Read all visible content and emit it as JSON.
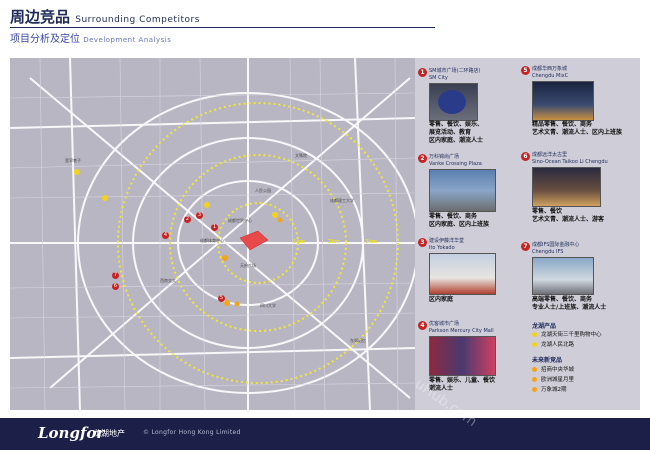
{
  "header": {
    "title_cn": "周边竞品",
    "title_en": "Surrounding Competitors",
    "subtitle_cn": "项目分析及定位",
    "subtitle_en": "Development Analysis"
  },
  "map": {
    "ring_labels": [
      "1km",
      "2km",
      "3km"
    ],
    "site_labels": [
      "成都世贸中心",
      "天府广场",
      "成都体育中心",
      "四川大学",
      "西南交大",
      "人民公园",
      "文殊院",
      "宽窄巷子",
      "成都理工大学",
      "东郊记忆"
    ]
  },
  "competitors": [
    {
      "num": "1",
      "name": "SM城市广场(二环路店)",
      "name_en": "SM City",
      "desc": "零售、餐饮、娱乐、\n展览活动、教育\n区内家庭、潮流人士"
    },
    {
      "num": "2",
      "name": "万科锦尚广场",
      "name_en": "Vanke Crossing Plaza",
      "desc": "零售、餐饮、商务\n区内家庭、区内上班族"
    },
    {
      "num": "3",
      "name": "建设伊藤洋华堂",
      "name_en": "Ito Yokado",
      "desc": "区内家庭"
    },
    {
      "num": "4",
      "name": "优客城市广场",
      "name_en": "Parkson Mercury City Mall",
      "desc": "零售、娱乐、儿童、餐饮\n潮流人士"
    },
    {
      "num": "5",
      "name": "成都华西万象城",
      "name_en": "Chengdu MixC",
      "desc": "精品零售、餐饮、商务\n艺术文青、潮流人士、区内上班族"
    },
    {
      "num": "6",
      "name": "成都远洋太古里",
      "name_en": "Sino-Ocean Taikoo Li Chengdu",
      "desc": "零售、餐饮\n艺术文青、潮流人士、游客"
    },
    {
      "num": "7",
      "name": "成都IFS国际金融中心",
      "name_en": "Chengdu IFS",
      "desc": "高端零售、餐饮、商务\n专业人士/上班族、潮流人士"
    }
  ],
  "legend": {
    "group1_title": "龙湖产品",
    "group1": [
      {
        "label": "龙湖天街三千里购物中心",
        "color": "#f2d21a"
      },
      {
        "label": "龙湖人民北路",
        "color": "#f2d21a"
      }
    ],
    "group2_title": "未来新竞品",
    "group2": [
      {
        "label": "招商中央华城",
        "color": "#f2a41a"
      },
      {
        "label": "欧洲城星月里",
        "color": "#f2a41a"
      },
      {
        "label": "万象城2期",
        "color": "#f2a41a"
      }
    ]
  },
  "footer": {
    "logo": "Longfor",
    "logo_cn": "龙湖地产",
    "copyright": "© Longfor Hong Kong Limited",
    "watermark": "uHub.com"
  },
  "colors": {
    "brand_navy": "#1c2048",
    "marker_red": "#c62323",
    "ring_yellow": "#f2e830",
    "map_bg": "#b9b6c4",
    "panel_bg": "#cfced8"
  }
}
